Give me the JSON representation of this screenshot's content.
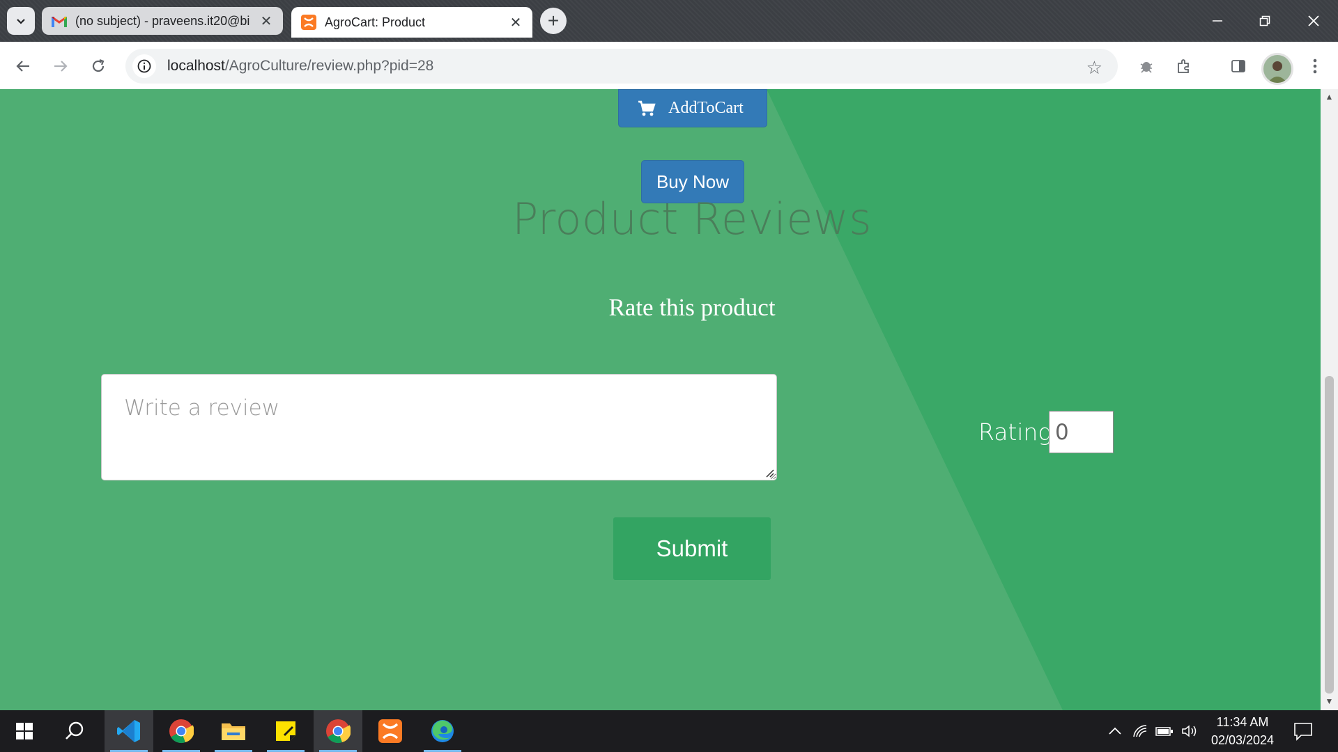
{
  "browser": {
    "tabs": [
      {
        "title": "(no subject) - praveens.it20@bi",
        "icon": "gmail-icon",
        "active": false
      },
      {
        "title": "AgroCart: Product",
        "icon": "xampp-icon",
        "active": true
      }
    ],
    "address_bar": {
      "host": "localhost",
      "path": "/AgroCulture/review.php?pid=28"
    }
  },
  "page": {
    "add_to_cart_label": "AddToCart",
    "buy_now_label": "Buy Now",
    "reviews_title": "Product Reviews",
    "rate_title": "Rate this product",
    "review_placeholder": "Write a review",
    "rating_label": "Rating:",
    "rating_value": "0",
    "submit_label": "Submit"
  },
  "taskbar": {
    "apps": [
      "start-icon",
      "search-icon",
      "vscode-icon",
      "chrome-icon",
      "file-explorer-icon",
      "sticky-notes-icon",
      "chrome-icon",
      "xampp-icon",
      "edge-icon"
    ],
    "clock": {
      "time": "11:34 AM",
      "date": "02/03/2024"
    }
  },
  "colors": {
    "page_bg_dark": "#3aa867",
    "page_bg_light": "#4fae73",
    "primary_button": "#337ab7",
    "submit_button": "#33a462"
  }
}
